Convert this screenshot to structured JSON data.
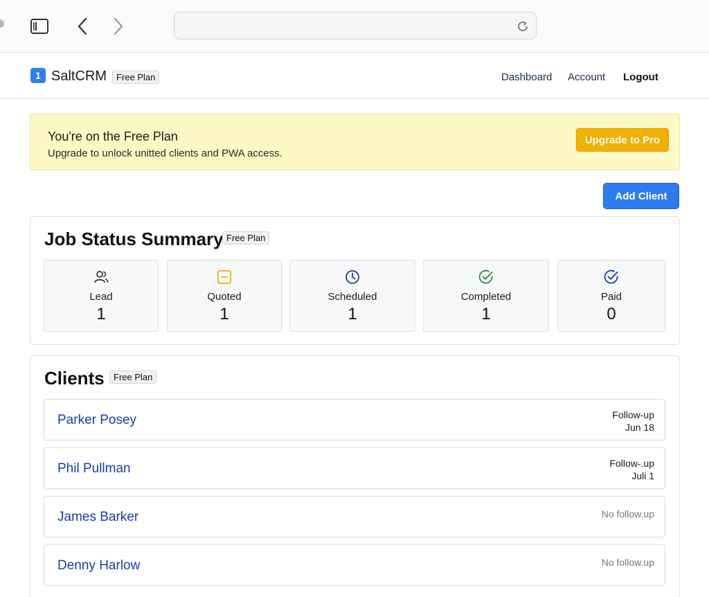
{
  "browser": {
    "address_value": "",
    "icons": {
      "sidebar": "sidebar-icon",
      "back": "chevron-left-icon",
      "forward": "chevron-right-icon",
      "reload": "reload-icon"
    }
  },
  "header": {
    "logo_text": "1",
    "brand": "SaltCRM",
    "plan_badge": "Free Plan",
    "nav": {
      "dashboard": "Dashboard",
      "account": "Account",
      "logout": "Logout"
    }
  },
  "banner": {
    "title": "You're on the Free Plan",
    "text": "Upgrade to unlock unitted clients and PWA access.",
    "button": "Upgrade to Pro"
  },
  "actions": {
    "add_client": "Add Client"
  },
  "status_summary": {
    "title": "Job Status Summary",
    "badge": "Free Plan",
    "items": [
      {
        "label": "Lead",
        "count": "1",
        "icon": "users-icon",
        "color": "#333333"
      },
      {
        "label": "Quoted",
        "count": "1",
        "icon": "quote-box-icon",
        "color": "#f0b100"
      },
      {
        "label": "Scheduled",
        "count": "1",
        "icon": "clock-icon",
        "color": "#1d3f8f"
      },
      {
        "label": "Completed",
        "count": "1",
        "icon": "check-circle-icon",
        "color": "#2e8b3a"
      },
      {
        "label": "Paid",
        "count": "0",
        "icon": "check-circle-icon",
        "color": "#1d3f8f"
      }
    ]
  },
  "clients": {
    "title": "Clients",
    "badge": "Free Plan",
    "rows": [
      {
        "name": "Parker Posey",
        "followup_label": "Follow-up",
        "followup_date": "Jun 18"
      },
      {
        "name": "Phil Pullman",
        "followup_label": "Follow-.up",
        "followup_date": "Juli 1"
      },
      {
        "name": "James Barker",
        "followup_label": "No follow.up",
        "followup_date": ""
      },
      {
        "name": "Denny Harlow",
        "followup_label": "No follow.up",
        "followup_date": ""
      }
    ]
  },
  "colors": {
    "accent": "#2e7bf0",
    "warning": "#f0b100",
    "banner_bg": "#fdf8c4",
    "link": "#173f9e"
  }
}
